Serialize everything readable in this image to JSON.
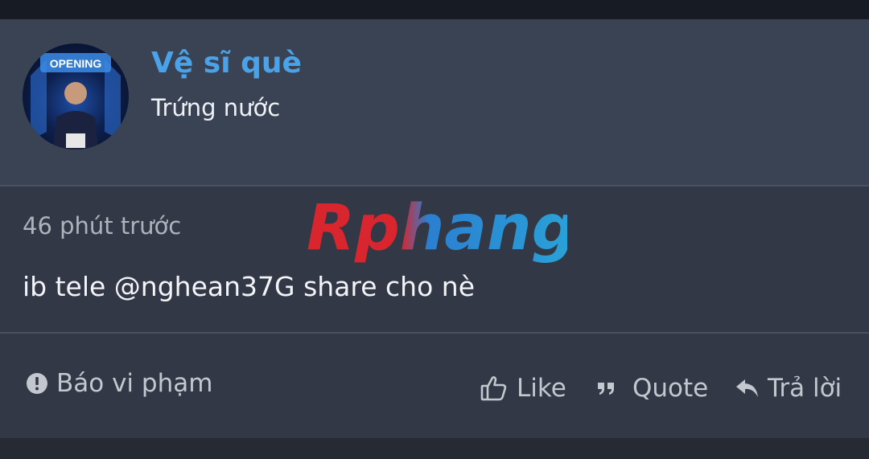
{
  "post": {
    "author": {
      "name": "Vệ sĩ què",
      "title": "Trứng nước",
      "avatar_icon": "user-avatar"
    },
    "time": "46 phút trước",
    "message": "ib tele @nghean37G share cho nè",
    "watermark": "Rphang"
  },
  "actions": {
    "report_label": "Báo vi phạm",
    "like_label": "Like",
    "quote_label": "Quote",
    "reply_label": "Trả lời"
  },
  "colors": {
    "username": "#4aa3e8",
    "header_bg": "#3a4353",
    "body_bg": "#323845"
  }
}
